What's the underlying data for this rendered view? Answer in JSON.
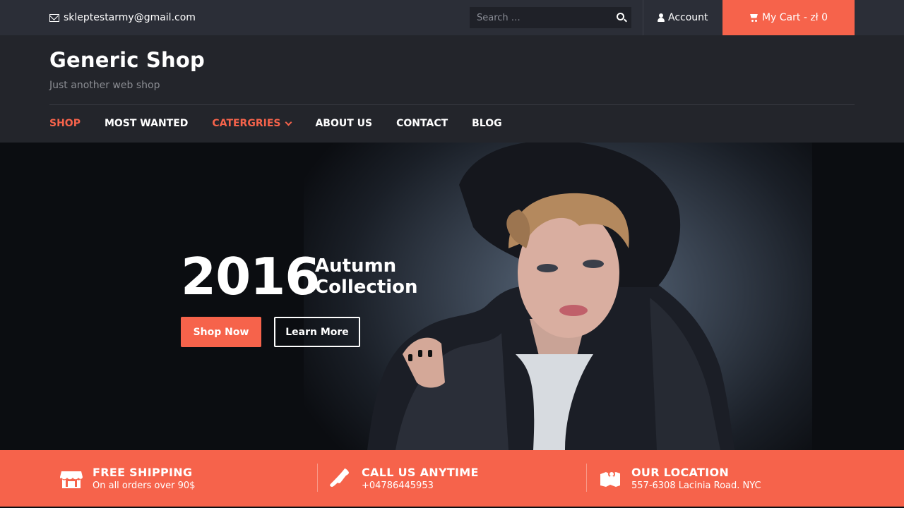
{
  "topbar": {
    "email": "skleptestarmy@gmail.com",
    "search_placeholder": "Search …",
    "account_label": "Account",
    "cart_label": "My Cart - zł 0"
  },
  "header": {
    "brand": "Generic Shop",
    "tagline": "Just another web shop"
  },
  "nav": {
    "items": [
      {
        "label": "SHOP"
      },
      {
        "label": "MOST WANTED"
      },
      {
        "label": "CATERGRIES"
      },
      {
        "label": "ABOUT US"
      },
      {
        "label": "CONTACT"
      },
      {
        "label": "BLOG"
      }
    ]
  },
  "hero": {
    "year": "2016",
    "line1": "Autumn",
    "line2": "Collection",
    "shop_now": "Shop Now",
    "learn_more": "Learn More"
  },
  "features": [
    {
      "title": "FREE SHIPPING",
      "subtitle": "On all orders over 90$",
      "icon": "store-icon"
    },
    {
      "title": "CALL US ANYTIME",
      "subtitle": "+04786445953",
      "icon": "phone-icon"
    },
    {
      "title": "OUR LOCATION",
      "subtitle": "557-6308 Lacinia Road. NYC",
      "icon": "map-icon"
    }
  ],
  "colors": {
    "accent": "#f6634b",
    "topbar": "#2b2e37",
    "header": "#23252b"
  }
}
